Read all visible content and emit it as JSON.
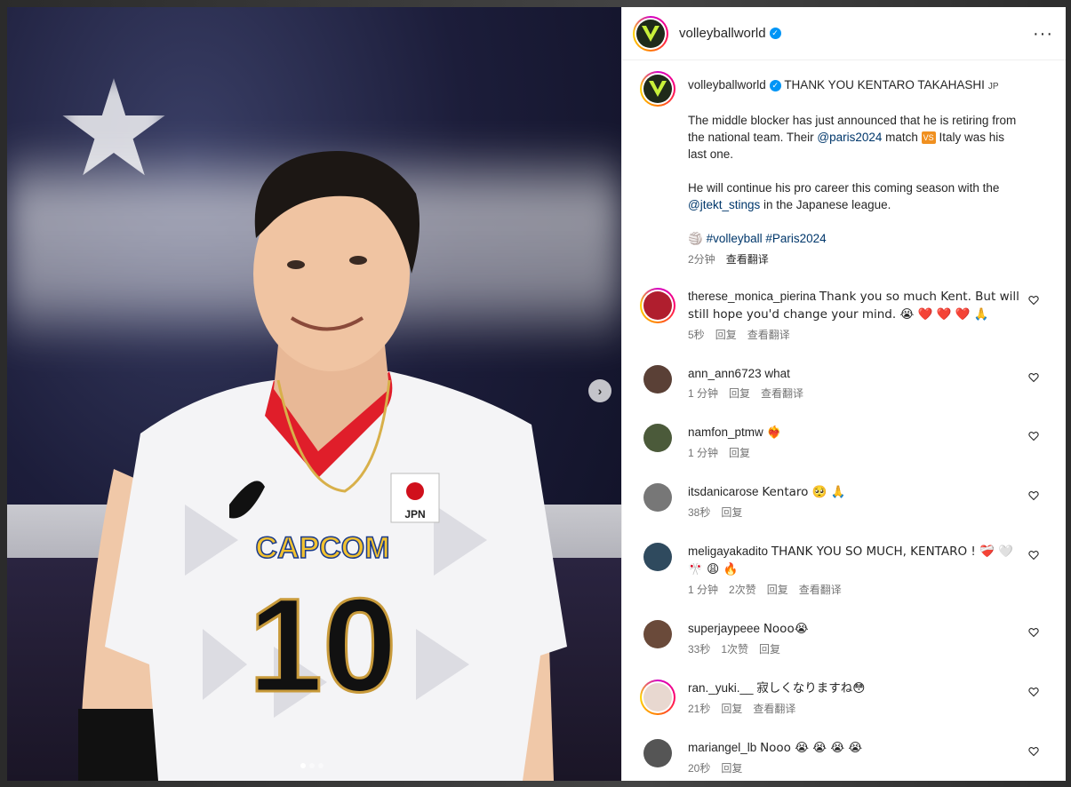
{
  "header": {
    "username": "volleyballworld",
    "more_icon": "more-horizontal-icon"
  },
  "media": {
    "next_icon": "chevron-right-icon",
    "slide_count": 3,
    "current_slide": 1
  },
  "caption": {
    "username": "volleyballworld",
    "title": "THANK YOU KENTARO TAKAHASHI",
    "flag": "JP",
    "line1": "The middle blocker has just announced that he is retiring from the national team. Their",
    "mention1": "@paris2024",
    "line1b": "match",
    "vs_badge": "VS",
    "line1c": "Italy was his last one.",
    "line2": "He will continue his pro career this coming season with the",
    "mention2": "@jtekt_stings",
    "line2b": "in the Japanese league.",
    "volleyball_emoji": "🏐",
    "hashtag1": "#volleyball",
    "hashtag2": "#Paris2024",
    "time": "2分钟",
    "translate": "查看翻译"
  },
  "comments": [
    {
      "username": "therese_monica_pierina",
      "text": "Thank you so much Kent. But will still hope you'd change your mind. 😭 ❤️ ❤️ ❤️ 🙏",
      "time": "5秒",
      "reply": "回复",
      "translate": "查看翻译",
      "ring": true,
      "avatar_color": "#9a1d2a"
    },
    {
      "username": "ann_ann6723",
      "text": "what",
      "time": "1 分钟",
      "reply": "回复",
      "translate": "查看翻译",
      "avatar_color": "#5a4036"
    },
    {
      "username": "namfon_ptmw",
      "text": "❤️‍🔥",
      "time": "1 分钟",
      "reply": "回复",
      "avatar_color": "#4b5a3a"
    },
    {
      "username": "itsdanicarose",
      "text": "Kentaro 🥺 🙏",
      "time": "38秒",
      "reply": "回复",
      "avatar_color": "#777"
    },
    {
      "username": "meligayakadito",
      "text": "THANK YOU SO MUCH, KENTARO ! ❤️‍🩹 🤍 🎌 😩 🔥",
      "time": "1 分钟",
      "likes": "2次赞",
      "reply": "回复",
      "translate": "查看翻译",
      "avatar_color": "#2f4a5e"
    },
    {
      "username": "superjaypeee",
      "text": "Nooo😭",
      "time": "33秒",
      "likes": "1次赞",
      "reply": "回复",
      "avatar_color": "#6a4a3a"
    },
    {
      "username": "ran._yuki.__",
      "text": "寂しくなりますね😳",
      "time": "21秒",
      "reply": "回复",
      "translate": "查看翻译",
      "ring": true,
      "avatar_color": "#e0d0c8"
    },
    {
      "username": "mariangel_lb",
      "text": "Nooo 😭 😭 😭 😭",
      "time": "20秒",
      "reply": "回复",
      "avatar_color": "#555"
    }
  ],
  "icons": {
    "heart": "heart-outline-icon",
    "verified": "verified-badge-icon"
  },
  "colors": {
    "link": "#00376b",
    "verified": "#0095f6",
    "meta": "#737373"
  }
}
